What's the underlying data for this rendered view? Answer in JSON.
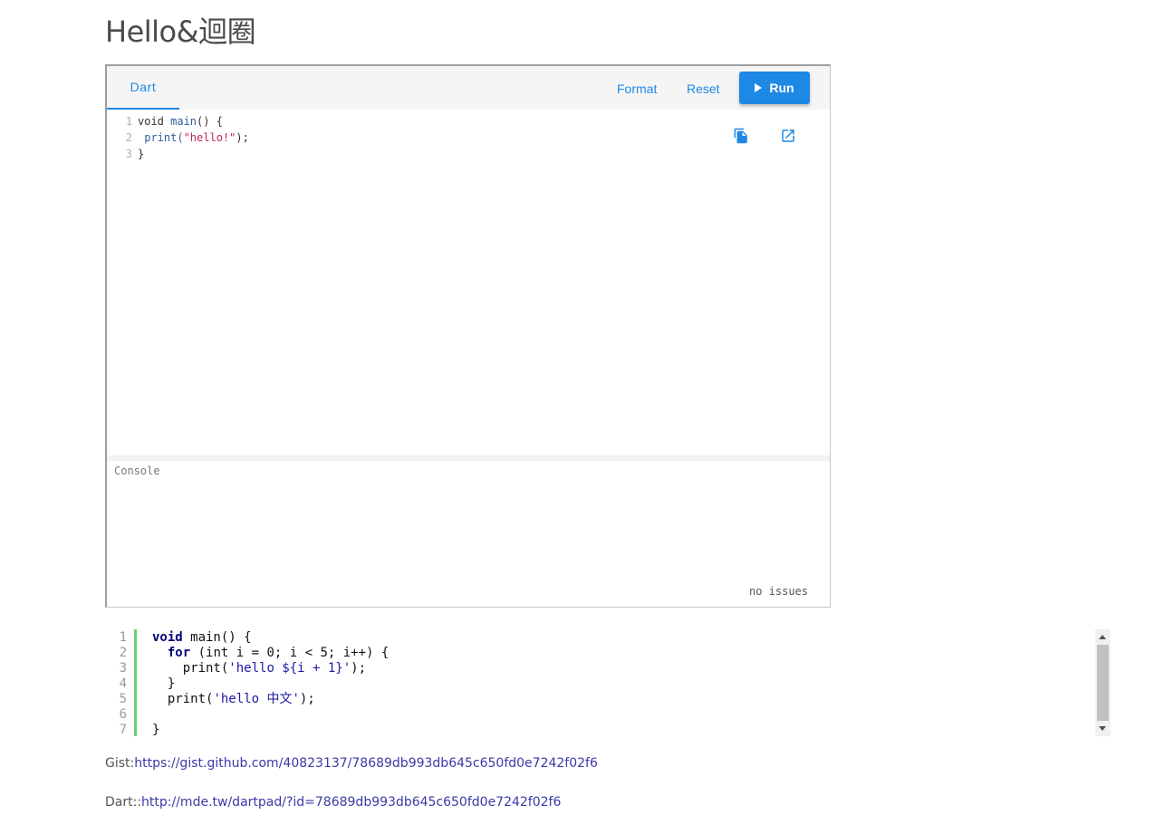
{
  "page": {
    "title": "Hello&迴圈"
  },
  "dartpad": {
    "tab_label": "Dart",
    "format_label": "Format",
    "reset_label": "Reset",
    "run_label": "Run",
    "accent_color": "#1e88e5",
    "code_lines": [
      {
        "num": "1",
        "parts": [
          {
            "t": "void ",
            "c": "kw"
          },
          {
            "t": "main",
            "c": "fn"
          },
          {
            "t": "() {",
            "c": "kw"
          }
        ]
      },
      {
        "num": "2",
        "parts": [
          {
            "t": " print(",
            "c": "fn"
          },
          {
            "t": "\"hello!\"",
            "c": "str"
          },
          {
            "t": ");",
            "c": "kw"
          }
        ]
      },
      {
        "num": "3",
        "parts": [
          {
            "t": "}",
            "c": "kw"
          }
        ]
      }
    ],
    "copy_icon": "copy-icon",
    "open_icon": "open-in-new-icon",
    "console_label": "Console",
    "issues_label": "no issues"
  },
  "code_block": {
    "line_numbers": [
      "1",
      "2",
      "3",
      "4",
      "5",
      "6",
      "7"
    ],
    "lines": [
      [
        {
          "t": "void",
          "c": "cb-kw"
        },
        {
          "t": " main() {",
          "c": ""
        }
      ],
      [
        {
          "t": "  ",
          "c": ""
        },
        {
          "t": "for",
          "c": "cb-kw"
        },
        {
          "t": " (int i = 0; i < 5; i++) {",
          "c": ""
        }
      ],
      [
        {
          "t": "    print(",
          "c": ""
        },
        {
          "t": "'hello ${i + 1}'",
          "c": "cb-str"
        },
        {
          "t": ");",
          "c": ""
        }
      ],
      [
        {
          "t": "  }",
          "c": ""
        }
      ],
      [
        {
          "t": "  print(",
          "c": ""
        },
        {
          "t": "'hello 中文'",
          "c": "cb-str"
        },
        {
          "t": ");",
          "c": ""
        }
      ],
      [
        {
          "t": "",
          "c": ""
        }
      ],
      [
        {
          "t": "}",
          "c": ""
        }
      ]
    ]
  },
  "links": {
    "gist_prefix": "Gist:",
    "gist_url": "https://gist.github.com/40823137/78689db993db645c650fd0e7242f02f6",
    "dart_prefix": "Dart::",
    "dart_url": "http://mde.tw/dartpad/?id=78689db993db645c650fd0e7242f02f6"
  }
}
